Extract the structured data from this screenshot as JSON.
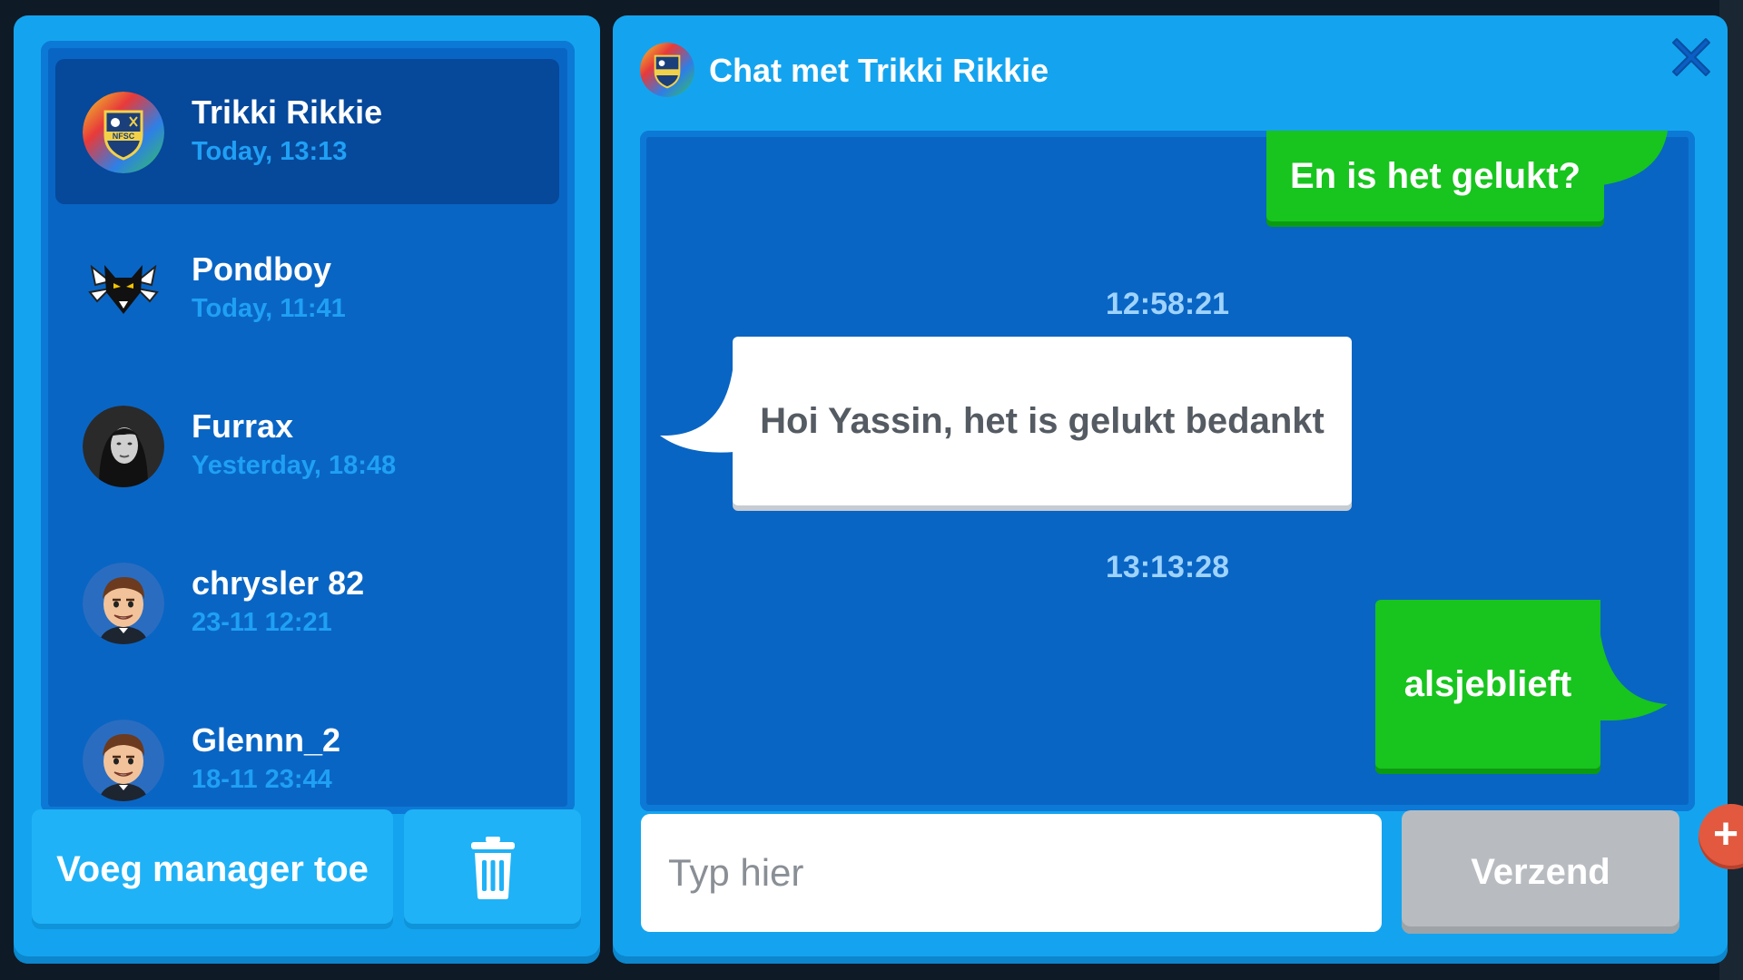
{
  "contacts": [
    {
      "name": "Trikki Rikkie",
      "time": "Today, 13:13",
      "avatar": "club-crest-icon",
      "selected": true
    },
    {
      "name": "Pondboy",
      "time": "Today, 11:41",
      "avatar": "wolf-emblem-icon",
      "selected": false
    },
    {
      "name": "Furrax",
      "time": "Yesterday, 18:48",
      "avatar": "photo-avatar",
      "selected": false
    },
    {
      "name": "chrysler 82",
      "time": "23-11 12:21",
      "avatar": "manager-face-icon",
      "selected": false
    },
    {
      "name": "Glennn_2",
      "time": "18-11 23:44",
      "avatar": "manager-face-icon",
      "selected": false
    }
  ],
  "left_actions": {
    "add_manager_label": "Voeg manager toe",
    "delete_icon": "trash-icon"
  },
  "chat": {
    "title": "Chat met Trikki Rikkie",
    "avatar": "club-crest-icon",
    "close_icon": "close-icon",
    "messages": [
      {
        "direction": "out",
        "text": "En is het gelukt?"
      },
      {
        "type": "timestamp",
        "text": "12:58:21"
      },
      {
        "direction": "in",
        "text": "Hoi Yassin, het is gelukt bedankt"
      },
      {
        "type": "timestamp",
        "text": "13:13:28"
      },
      {
        "direction": "out",
        "text": "alsjeblieft"
      }
    ],
    "input_placeholder": "Typ hier",
    "send_label": "Verzend"
  },
  "colors": {
    "panel": "#14a4ef",
    "list_bg": "#0965c4",
    "selected_row": "#06489a",
    "outgoing_bubble": "#18c41e",
    "incoming_bubble": "#ffffff",
    "send_disabled": "#b8bcc1",
    "close_icon": "#0b5fc4"
  }
}
